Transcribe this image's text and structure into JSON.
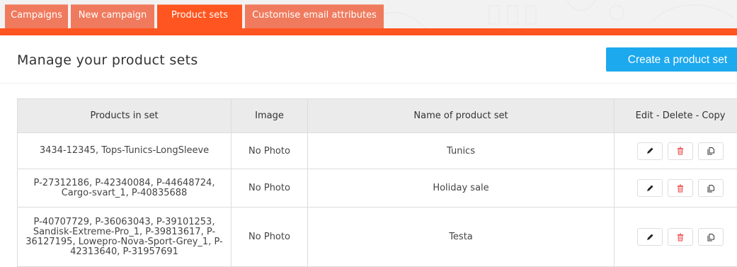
{
  "tabs": [
    {
      "label": "Campaigns",
      "active": false
    },
    {
      "label": "New campaign",
      "active": false
    },
    {
      "label": "Product sets",
      "active": true
    },
    {
      "label": "Customise email attributes",
      "active": false
    }
  ],
  "colors": {
    "accent": "#ff5520",
    "tab_inactive": "#f07a5d",
    "primary_button": "#1da9ee",
    "link": "#3a86c8",
    "delete_icon": "#f06060"
  },
  "page": {
    "title": "Manage your product sets",
    "create_button": "Create a product set"
  },
  "table": {
    "headers": {
      "products": "Products in set",
      "image": "Image",
      "name": "Name of product set",
      "actions": "Edit - Delete - Copy"
    },
    "rows": [
      {
        "products": "3434-12345, Tops-Tunics-LongSleeve",
        "image": "No Photo",
        "name": "Tunics"
      },
      {
        "products": "P-27312186, P-42340084, P-44648724, Cargo-svart_1, P-40835688",
        "image": "No Photo",
        "name": "Holiday sale"
      },
      {
        "products": "P-40707729, P-36063043, P-39101253, Sandisk-Extreme-Pro_1, P-39813617, P-36127195, Lowepro-Nova-Sport-Grey_1, P-42313640, P-31957691",
        "image": "No Photo",
        "name": "Testa"
      }
    ],
    "row_actions": [
      "pencil-icon",
      "trash-icon",
      "copy-icon"
    ]
  }
}
